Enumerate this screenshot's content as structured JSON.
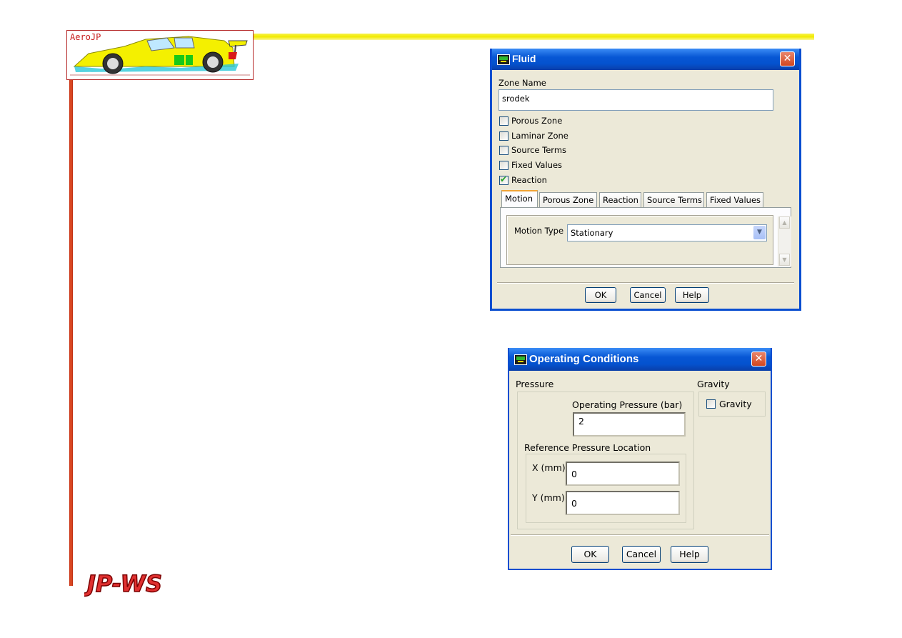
{
  "slide": {
    "logo_text": "AeroJP",
    "footer_logo_text": "JP-WS"
  },
  "fluid_dialog": {
    "title": "Fluid",
    "close_glyph": "✕",
    "zone_name_label": "Zone Name",
    "zone_name_value": "srodek",
    "options": [
      {
        "label": "Porous Zone",
        "checked": false
      },
      {
        "label": "Laminar Zone",
        "checked": false
      },
      {
        "label": "Source Terms",
        "checked": false
      },
      {
        "label": "Fixed Values",
        "checked": false
      },
      {
        "label": "Reaction",
        "checked": true
      }
    ],
    "tabs": [
      "Motion",
      "Porous Zone",
      "Reaction",
      "Source Terms",
      "Fixed Values"
    ],
    "active_tab": "Motion",
    "motion_type_label": "Motion Type",
    "motion_type_value": "Stationary",
    "buttons": {
      "ok": "OK",
      "cancel": "Cancel",
      "help": "Help"
    }
  },
  "operating_dialog": {
    "title": "Operating Conditions",
    "close_glyph": "✕",
    "pressure_label": "Pressure",
    "operating_pressure_label": "Operating Pressure (bar)",
    "operating_pressure_value": "2",
    "reference_location_label": "Reference Pressure Location",
    "x_label": "X (mm)",
    "x_value": "0",
    "y_label": "Y (mm)",
    "y_value": "0",
    "gravity_group_label": "Gravity",
    "gravity_checkbox_label": "Gravity",
    "gravity_checked": false,
    "buttons": {
      "ok": "OK",
      "cancel": "Cancel",
      "help": "Help"
    }
  },
  "colors": {
    "titlebar": "#0757d4",
    "dialog_bg": "#ece9d8",
    "accent_yellow": "#f2ea00",
    "accent_red": "#c62d0f"
  }
}
